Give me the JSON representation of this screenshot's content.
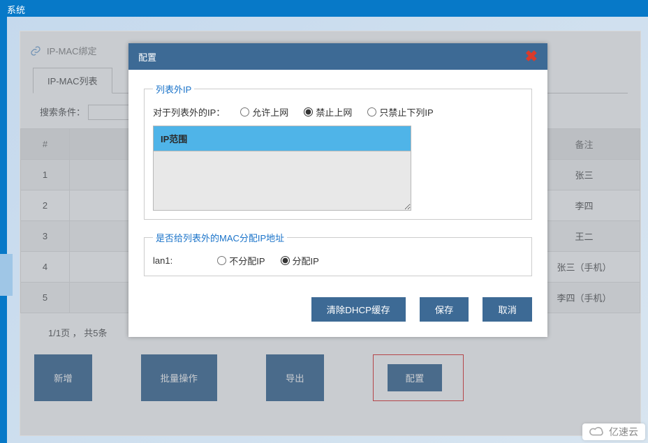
{
  "topbar": {
    "title": "系统"
  },
  "breadcrumb": {
    "label": "IP-MAC绑定"
  },
  "tabs": {
    "ipmac_list": "IP-MAC列表"
  },
  "search": {
    "label": "搜索条件："
  },
  "table": {
    "headers": {
      "idx": "#",
      "remark": "备注"
    },
    "rows": [
      {
        "idx": "1",
        "remark": "张三"
      },
      {
        "idx": "2",
        "remark": "李四"
      },
      {
        "idx": "3",
        "remark": "王二"
      },
      {
        "idx": "4",
        "remark": "张三（手机）"
      },
      {
        "idx": "5",
        "remark": "李四（手机）"
      }
    ]
  },
  "pager": {
    "text": "1/1页 ， 共5条"
  },
  "buttons": {
    "add": "新增",
    "batch": "批量操作",
    "export": "导出",
    "config": "配置"
  },
  "modal": {
    "title": "配置",
    "fs1": {
      "legend": "列表外IP",
      "prompt": "对于列表外的IP：",
      "opt_allow": "允许上网",
      "opt_forbid": "禁止上网",
      "opt_only_below": "只禁止下列IP",
      "ip_range_header": "IP范围",
      "selected": "forbid"
    },
    "fs2": {
      "legend": "是否给列表外的MAC分配IP地址",
      "lan_label": "lan1:",
      "opt_no": "不分配IP",
      "opt_yes": "分配IP",
      "selected": "yes"
    },
    "footer": {
      "clear": "清除DHCP缓存",
      "save": "保存",
      "cancel": "取消"
    }
  },
  "watermark": {
    "text": "亿速云"
  }
}
